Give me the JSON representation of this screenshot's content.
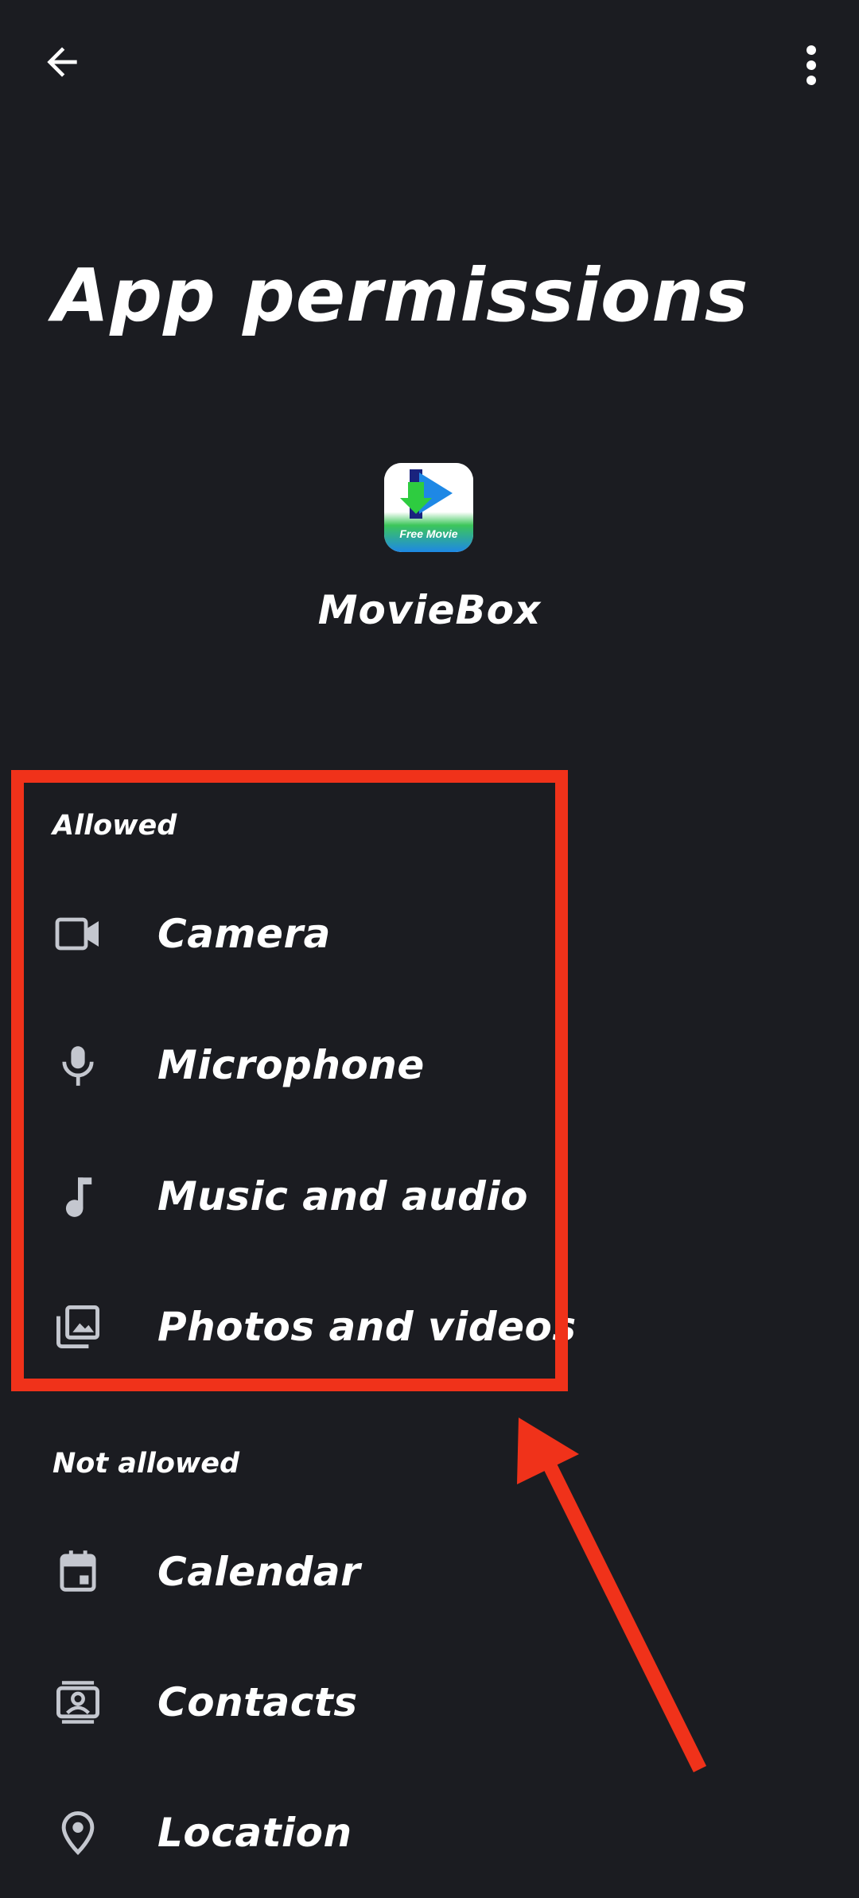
{
  "header": {
    "back_icon": "arrow-left-icon",
    "more_icon": "more-vert-icon"
  },
  "page": {
    "title": "App permissions"
  },
  "app": {
    "name": "MovieBox",
    "icon_caption": "Free Movie"
  },
  "allowed": {
    "header": "Allowed",
    "items": [
      {
        "label": "Camera",
        "icon": "videocam-icon"
      },
      {
        "label": "Microphone",
        "icon": "mic-icon"
      },
      {
        "label": "Music and audio",
        "icon": "music-note-icon"
      },
      {
        "label": "Photos and videos",
        "icon": "photo-library-icon"
      }
    ]
  },
  "not_allowed": {
    "header": "Not allowed",
    "items": [
      {
        "label": "Calendar",
        "icon": "calendar-icon"
      },
      {
        "label": "Contacts",
        "icon": "contacts-icon"
      },
      {
        "label": "Location",
        "icon": "location-pin-icon"
      }
    ]
  },
  "annotation": {
    "color": "#f0321a"
  },
  "colors": {
    "background": "#1b1c21",
    "text": "#ffffff",
    "icon": "#c4c7cf"
  }
}
